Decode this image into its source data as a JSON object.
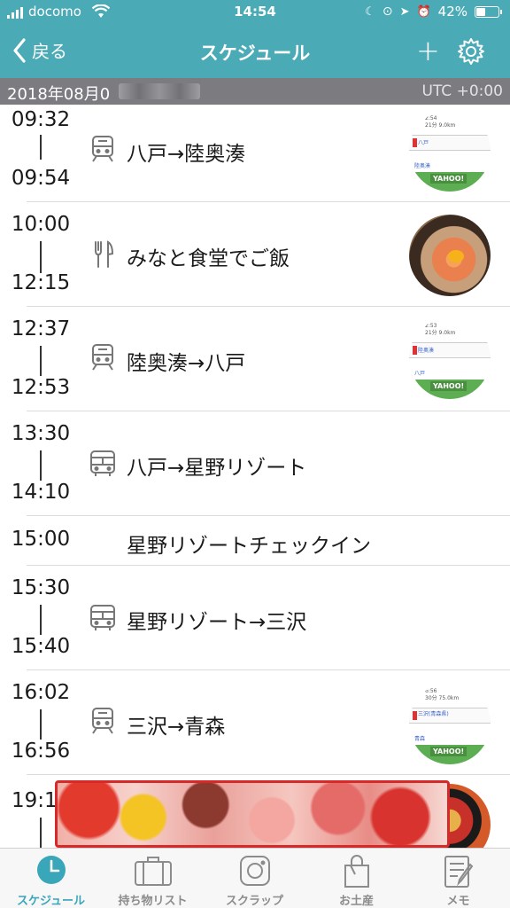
{
  "status_bar": {
    "carrier": "docomo",
    "time": "14:54",
    "battery": "42%",
    "battery_level": 0.42
  },
  "nav": {
    "back_label": "戻る",
    "title": "スケジュール",
    "add_label": "+"
  },
  "date_bar": {
    "date": "2018年08月0",
    "timezone": "UTC +0:00"
  },
  "schedule": [
    {
      "start": "09:32",
      "end": "09:54",
      "title": "八戸→陸奥湊",
      "icon": "train-icon",
      "thumb": "map"
    },
    {
      "start": "10:00",
      "end": "12:15",
      "title": "みなと食堂でご飯",
      "icon": "fork-knife-icon",
      "thumb": "food"
    },
    {
      "start": "12:37",
      "end": "12:53",
      "title": "陸奥湊→八戸",
      "icon": "train-icon",
      "thumb": "map"
    },
    {
      "start": "13:30",
      "end": "14:10",
      "title": "八戸→星野リゾート",
      "icon": "bus-icon",
      "thumb": ""
    },
    {
      "start": "15:00",
      "end": "",
      "title": "星野リゾートチェックイン",
      "icon": "",
      "thumb": ""
    },
    {
      "start": "15:30",
      "end": "15:40",
      "title": "星野リゾート→三沢",
      "icon": "bus-icon",
      "thumb": ""
    },
    {
      "start": "16:02",
      "end": "16:56",
      "title": "三沢→青森",
      "icon": "train-icon",
      "thumb": "map"
    },
    {
      "start": "19:1",
      "end": "",
      "title": "",
      "icon": "",
      "thumb": "festival"
    }
  ],
  "map_thumbs": [
    {
      "line1": "2:54",
      "line2": "21分 9.0km",
      "station_top": "八戸",
      "station_bottom": "陸奥湊",
      "logo": "YAHOO!"
    },
    {
      "line1": "2:53",
      "line2": "21分 9.0km",
      "station_top": "陸奥湊",
      "station_bottom": "八戸",
      "logo": "YAHOO!"
    },
    {
      "line1": "6:56",
      "line2": "30分 75.0km",
      "station_top": "三沢(青森県)",
      "station_bottom": "青森",
      "logo": "YAHOO!"
    }
  ],
  "tabs": [
    {
      "label": "スケジュール",
      "icon": "clock-icon",
      "active": true
    },
    {
      "label": "持ち物リスト",
      "icon": "suitcase-icon",
      "active": false
    },
    {
      "label": "スクラップ",
      "icon": "camera-icon",
      "active": false
    },
    {
      "label": "お土産",
      "icon": "shopping-bag-icon",
      "active": false
    },
    {
      "label": "メモ",
      "icon": "memo-icon",
      "active": false
    }
  ],
  "colors": {
    "accent": "#4aaab5",
    "date_bar": "#7b7b80",
    "active_tab": "#3aa6ba",
    "inactive_tab": "#8c8c8c"
  }
}
